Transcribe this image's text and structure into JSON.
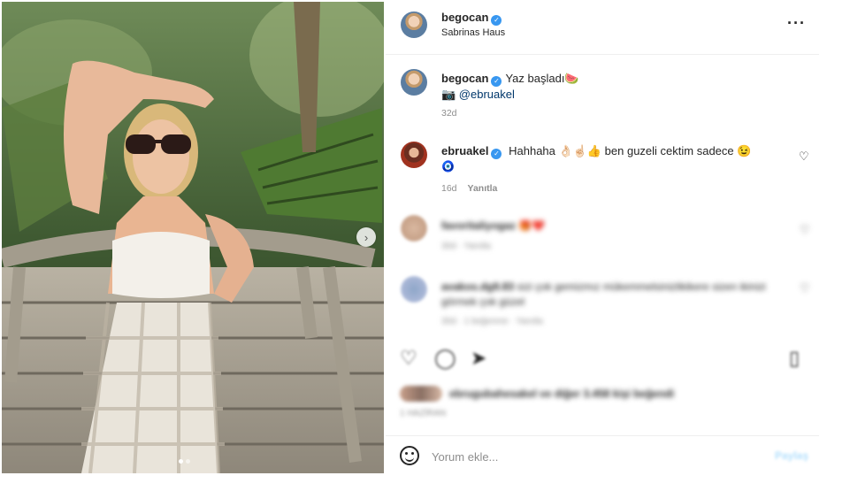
{
  "post": {
    "author": "begocan",
    "location": "Sabrinas Haus",
    "more_icon": "more-horizontal-icon"
  },
  "caption": {
    "username": "begocan",
    "text": "Yaz başladı🍉",
    "mention": "📷 @ebruakel",
    "time": "32d"
  },
  "comment": {
    "username": "ebruakel",
    "text": "Hahhaha 👌🏻☝🏻👍 ben guzeli cektim sadece 😉",
    "extra_emoji": "🧿",
    "time": "16d",
    "reply_label": "Yanıtla"
  },
  "blurred_comments": [
    {
      "username": "favoritaliyogaz",
      "text": "🎁❤️",
      "meta": "30d · Yanıtla"
    },
    {
      "username": "avakos.dg9.83",
      "text": "sizi çok gemizmız mükemmelsinizlikikere sizen ikinizi görmek çok güzel",
      "meta": "30d · 1 beğenme · Yanıtla"
    }
  ],
  "likes": {
    "text": "ebrugubahesakel ve diğer 3.458 kişi beğendi",
    "date": "1 HAZİRAN"
  },
  "comment_box": {
    "placeholder": "Yorum ekle...",
    "post_label": "Paylaş"
  },
  "colors": {
    "verified": "#3897f0",
    "mention": "#00376b",
    "muted": "#8e8e8e"
  }
}
